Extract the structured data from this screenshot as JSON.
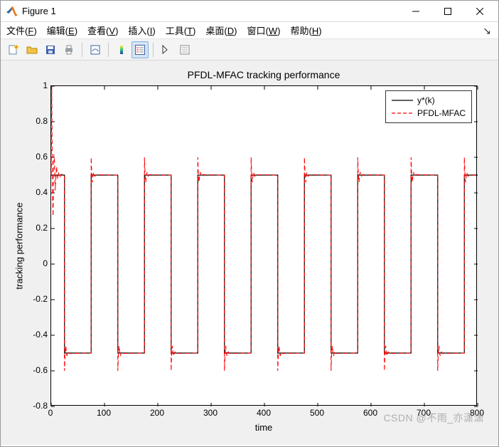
{
  "window": {
    "title": "Figure 1"
  },
  "menu": {
    "items": [
      {
        "label": "文件",
        "mn": "F"
      },
      {
        "label": "编辑",
        "mn": "E"
      },
      {
        "label": "查看",
        "mn": "V"
      },
      {
        "label": "插入",
        "mn": "I"
      },
      {
        "label": "工具",
        "mn": "T"
      },
      {
        "label": "桌面",
        "mn": "D"
      },
      {
        "label": "窗口",
        "mn": "W"
      },
      {
        "label": "帮助",
        "mn": "H"
      }
    ]
  },
  "chart": {
    "title": "PFDL-MFAC tracking performance",
    "xlabel": "time",
    "ylabel": "tracking performance",
    "legend": [
      "y*(k)",
      "PFDL-MFAC"
    ],
    "watermark": "CSDN @不雨_亦潇潇"
  },
  "chart_data": {
    "type": "line",
    "xlim": [
      0,
      800
    ],
    "ylim": [
      -0.8,
      1.0
    ],
    "xticks": [
      0,
      100,
      200,
      300,
      400,
      500,
      600,
      700,
      800
    ],
    "yticks": [
      -0.8,
      -0.6,
      -0.4,
      -0.2,
      0,
      0.2,
      0.4,
      0.6,
      0.8,
      1.0
    ],
    "x": [
      0,
      25,
      25,
      75,
      75,
      125,
      125,
      175,
      175,
      225,
      225,
      275,
      275,
      325,
      325,
      375,
      375,
      425,
      425,
      475,
      475,
      525,
      525,
      575,
      575,
      625,
      625,
      675,
      675,
      725,
      725,
      775,
      775,
      800
    ],
    "series": [
      {
        "name": "y*(k)",
        "color": "#000000",
        "dash": "",
        "values": [
          0.5,
          0.5,
          -0.5,
          -0.5,
          0.5,
          0.5,
          -0.5,
          -0.5,
          0.5,
          0.5,
          -0.5,
          -0.5,
          0.5,
          0.5,
          -0.5,
          -0.5,
          0.5,
          0.5,
          -0.5,
          -0.5,
          0.5,
          0.5,
          -0.5,
          -0.5,
          0.5,
          0.5,
          -0.5,
          -0.5,
          0.5,
          0.5,
          -0.5,
          -0.5,
          0.5,
          0.5
        ]
      },
      {
        "name": "PFDL-MFAC",
        "color": "#ff0000",
        "dash": "6,4",
        "values": [
          0.5,
          0.5,
          -0.5,
          -0.5,
          0.5,
          0.5,
          -0.5,
          -0.5,
          0.5,
          0.5,
          -0.5,
          -0.5,
          0.5,
          0.5,
          -0.5,
          -0.5,
          0.5,
          0.5,
          -0.5,
          -0.5,
          0.5,
          0.5,
          -0.5,
          -0.5,
          0.5,
          0.5,
          -0.5,
          -0.5,
          0.5,
          0.5,
          -0.5,
          -0.5,
          0.5,
          0.5
        ],
        "initial_transient": {
          "x_range": [
            0,
            20
          ],
          "peak": 1.0,
          "oscillation_amp_decay_from": 0.5
        },
        "step_overshoot": {
          "amp": 0.1,
          "decay_steps": 8
        }
      }
    ]
  }
}
